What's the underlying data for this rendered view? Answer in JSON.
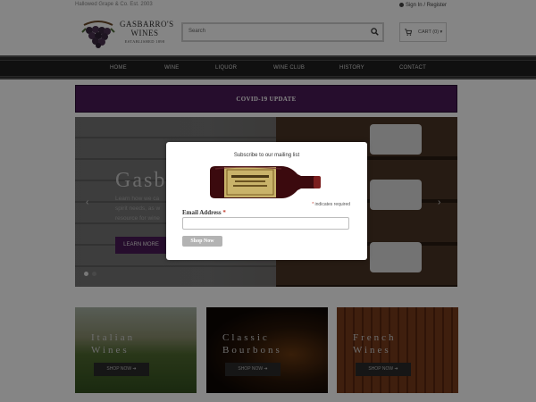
{
  "topbar": {
    "left_text": "Hallowed Grape & Co. Est. 2003",
    "account_link": "Sign In / Register"
  },
  "logo": {
    "name_line1": "GASBARRO'S",
    "name_line2": "WINES",
    "tagline": "ESTABLISHED 1898"
  },
  "search": {
    "placeholder": "Search"
  },
  "cart": {
    "label": "CART (0) ▾"
  },
  "nav": {
    "items": [
      "HOME",
      "WINE",
      "LIQUOR",
      "WINE CLUB",
      "HISTORY",
      "CONTACT"
    ]
  },
  "banner": {
    "text": "COVID-19 UPDATE"
  },
  "hero": {
    "title": "Gasb",
    "sub_lines": [
      "Learn how we ca",
      "spirit needs, as w",
      "resource for wine"
    ],
    "button": "LEARN MORE",
    "prev_arrow": "‹",
    "next_arrow": "›"
  },
  "tiles": [
    {
      "line1": "Italian",
      "line2": "Wines",
      "button": "SHOP NOW ➜"
    },
    {
      "line1": "Classic",
      "line2": "Bourbons",
      "button": "SHOP NOW ➜"
    },
    {
      "line1": "French",
      "line2": "Wines",
      "button": "SHOP NOW ➜"
    }
  ],
  "modal": {
    "title": "Subscribe to our mailing list",
    "required_note": "indicates required",
    "required_mark": "*",
    "email_label": "Email Address",
    "email_value": "",
    "submit": "Shop Now"
  },
  "colors": {
    "brand_purple": "#4a1a56",
    "nav_dark": "#1f1f1f",
    "required_red": "#c0392b",
    "overlay": "rgba(0,0,0,0.48)"
  }
}
